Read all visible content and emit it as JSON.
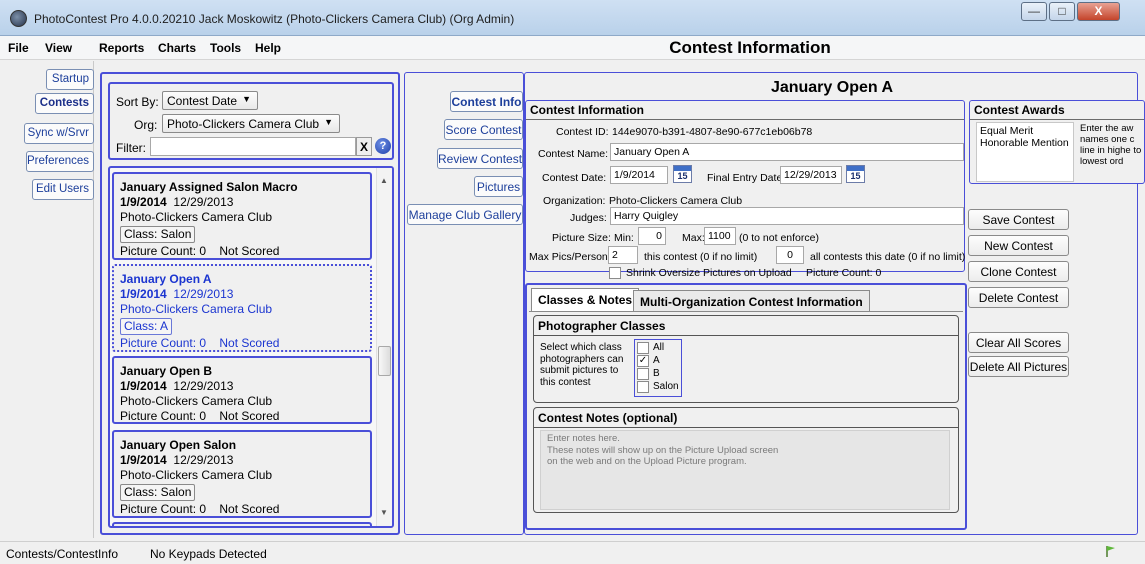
{
  "window": {
    "title": "PhotoContest Pro 4.0.0.20210 Jack Moskowitz (Photo-Clickers Camera Club) (Org Admin)",
    "minimize": "—",
    "maximize": "□",
    "close": "X"
  },
  "menu": [
    "File",
    "View",
    "Reports",
    "Charts",
    "Tools",
    "Help"
  ],
  "page_heading": "Contest Information",
  "nav": [
    "Startup",
    "Contests",
    "Sync w/Srvr",
    "Preferences",
    "Edit Users"
  ],
  "list_panel": {
    "sort_label": "Sort By:",
    "sort_value": "Contest Date",
    "org_label": "Org:",
    "org_value": "Photo-Clickers Camera Club",
    "filter_label": "Filter:",
    "filter_value": "",
    "clear_label": "X",
    "help_label": "?",
    "contests": [
      {
        "name": "January Assigned Salon Macro",
        "date": "1/9/2014",
        "entry": "12/29/2013",
        "org": "Photo-Clickers Camera Club",
        "class": "Class: Salon",
        "count": "Picture Count: 0",
        "status": "Not Scored"
      },
      {
        "name": "January Open A",
        "date": "1/9/2014",
        "entry": "12/29/2013",
        "org": "Photo-Clickers Camera Club",
        "class": "Class: A",
        "count": "Picture Count: 0",
        "status": "Not Scored"
      },
      {
        "name": "January Open B",
        "date": "1/9/2014",
        "entry": "12/29/2013",
        "org": "Photo-Clickers Camera Club",
        "class": "",
        "count": "Picture Count: 0",
        "status": "Not Scored"
      },
      {
        "name": "January Open Salon",
        "date": "1/9/2014",
        "entry": "12/29/2013",
        "org": "Photo-Clickers Camera Club",
        "class": "Class: Salon",
        "count": "Picture Count: 0",
        "status": "Not Scored"
      }
    ]
  },
  "subnav": [
    "Contest Info",
    "Score Contest",
    "Review Contest",
    "Pictures",
    "Manage Club Gallery"
  ],
  "contest": {
    "heading": "January Open A",
    "section_title": "Contest Information",
    "id_label": "Contest ID:",
    "id_value": "144e9070-b391-4807-8e90-677c1eb06b78",
    "name_label": "Contest Name:",
    "name_value": "January Open A",
    "date_label": "Contest Date:",
    "date_value": "1/9/2014",
    "final_label": "Final Entry Date:",
    "final_value": "12/29/2013",
    "cal_day": "15",
    "org_label": "Organization:",
    "org_value": "Photo-Clickers Camera Club",
    "judges_label": "Judges:",
    "judges_value": "Harry Quigley",
    "size_label": "Picture Size:",
    "min_label": "Min:",
    "min_value": "0",
    "max_label": "Max:",
    "max_value": "1100",
    "max_note": "(0 to not enforce)",
    "maxpics_label": "Max Pics/Person:",
    "maxpics_value": "2",
    "maxpics_note": "this contest (0 if no limit)",
    "allcontests_value": "0",
    "allcontests_note": "all contests this date (0 if no limit)",
    "shrink_label": "Shrink Oversize Pictures on Upload",
    "picture_count": "Picture Count: 0"
  },
  "awards": {
    "title": "Contest Awards",
    "items": [
      "Equal Merit",
      "Honorable Mention"
    ],
    "hint": "Enter the aw names one c line in highe to lowest ord"
  },
  "actions": [
    "Save Contest",
    "New Contest",
    "Clone Contest",
    "Delete Contest",
    "Clear All Scores",
    "Delete All Pictures"
  ],
  "tabs": [
    "Classes & Notes",
    "Multi-Organization Contest Information"
  ],
  "classes": {
    "title": "Photographer Classes",
    "description": "Select which class photographers can submit pictures to this contest",
    "options": [
      {
        "label": "All",
        "checked": false
      },
      {
        "label": "A",
        "checked": true
      },
      {
        "label": "B",
        "checked": false
      },
      {
        "label": "Salon",
        "checked": false
      }
    ],
    "check_mark": "✓"
  },
  "notes": {
    "title": "Contest Notes (optional)",
    "placeholder": "Enter notes here.\nThese notes will show up on the Picture Upload screen\non the web and on the Upload Picture program."
  },
  "status": {
    "path": "Contests/ContestInfo",
    "keypads": "No Keypads Detected"
  },
  "colors": {
    "accent_border": "#4a4fd8",
    "nav_text": "#1d3f9b",
    "selected_text": "#1b35d0"
  }
}
